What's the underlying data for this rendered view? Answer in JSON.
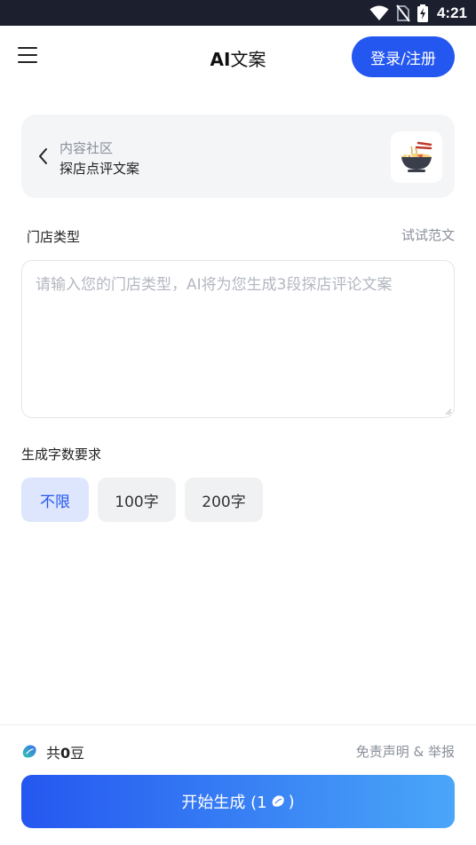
{
  "status_bar": {
    "time": "4:21",
    "icons": [
      "wifi-icon",
      "no-sim-icon",
      "battery-charging-icon"
    ]
  },
  "header": {
    "menu_icon": "hamburger-menu-icon",
    "title_prefix": "AI",
    "title_suffix": "文案",
    "login_label": "登录/注册",
    "login_color": "#2457f0"
  },
  "category": {
    "back_icon": "chevron-left-icon",
    "parent": "内容社区",
    "name": "探店点评文案",
    "thumb_icon": "noodle-bowl-icon"
  },
  "store_field": {
    "label": "门店类型",
    "example_link": "试试范文",
    "value": "",
    "placeholder": "请输入您的门店类型，AI将为您生成3段探店评论文案"
  },
  "word_count": {
    "label": "生成字数要求",
    "options": [
      "不限",
      "100字",
      "200字"
    ],
    "selected": "不限"
  },
  "footer": {
    "bean_icon": "bean-icon",
    "bean_prefix": "共",
    "bean_count": "0",
    "bean_unit": "豆",
    "disclaimer": "免责声明 & 举报",
    "generate_label": "开始生成 (1",
    "generate_suffix": ")",
    "generate_gradient": [
      "#2457f0",
      "#4aa6f8"
    ]
  }
}
